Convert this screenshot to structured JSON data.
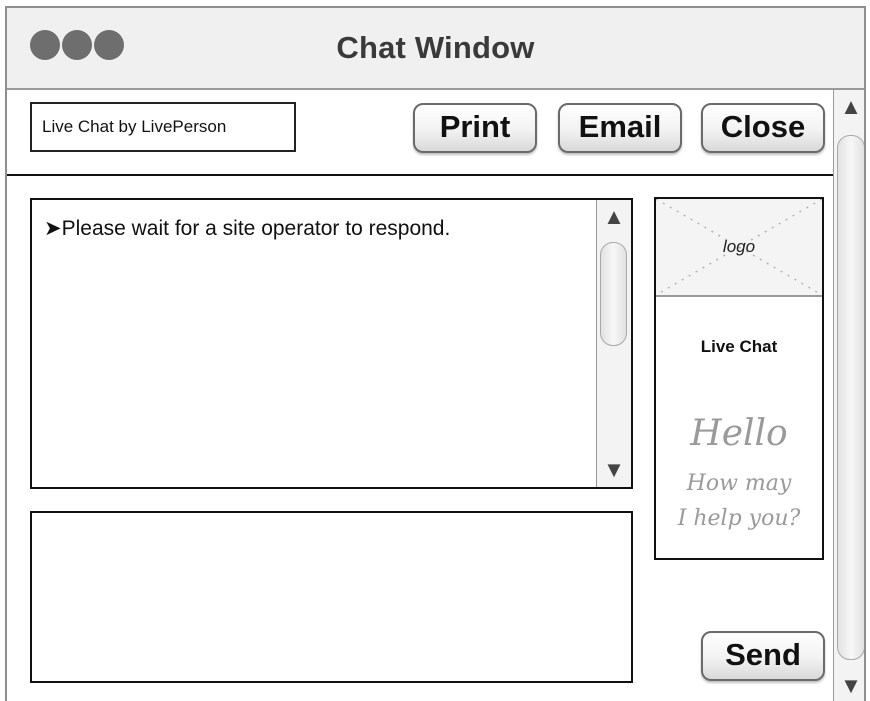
{
  "window": {
    "title": "Chat Window"
  },
  "header": {
    "branding": "Live Chat by LivePerson",
    "print_label": "Print",
    "email_label": "Email",
    "close_label": "Close"
  },
  "transcript": {
    "messages": [
      "➤Please wait for a site operator to respond."
    ]
  },
  "side_panel": {
    "logo_text": "logo",
    "title": "Live Chat",
    "greeting": "Hello",
    "prompt_line1": "How may",
    "prompt_line2": "I help you?"
  },
  "composer": {
    "send_label": "Send"
  },
  "icons": {
    "scroll_up": "▲",
    "scroll_down": "▼"
  }
}
